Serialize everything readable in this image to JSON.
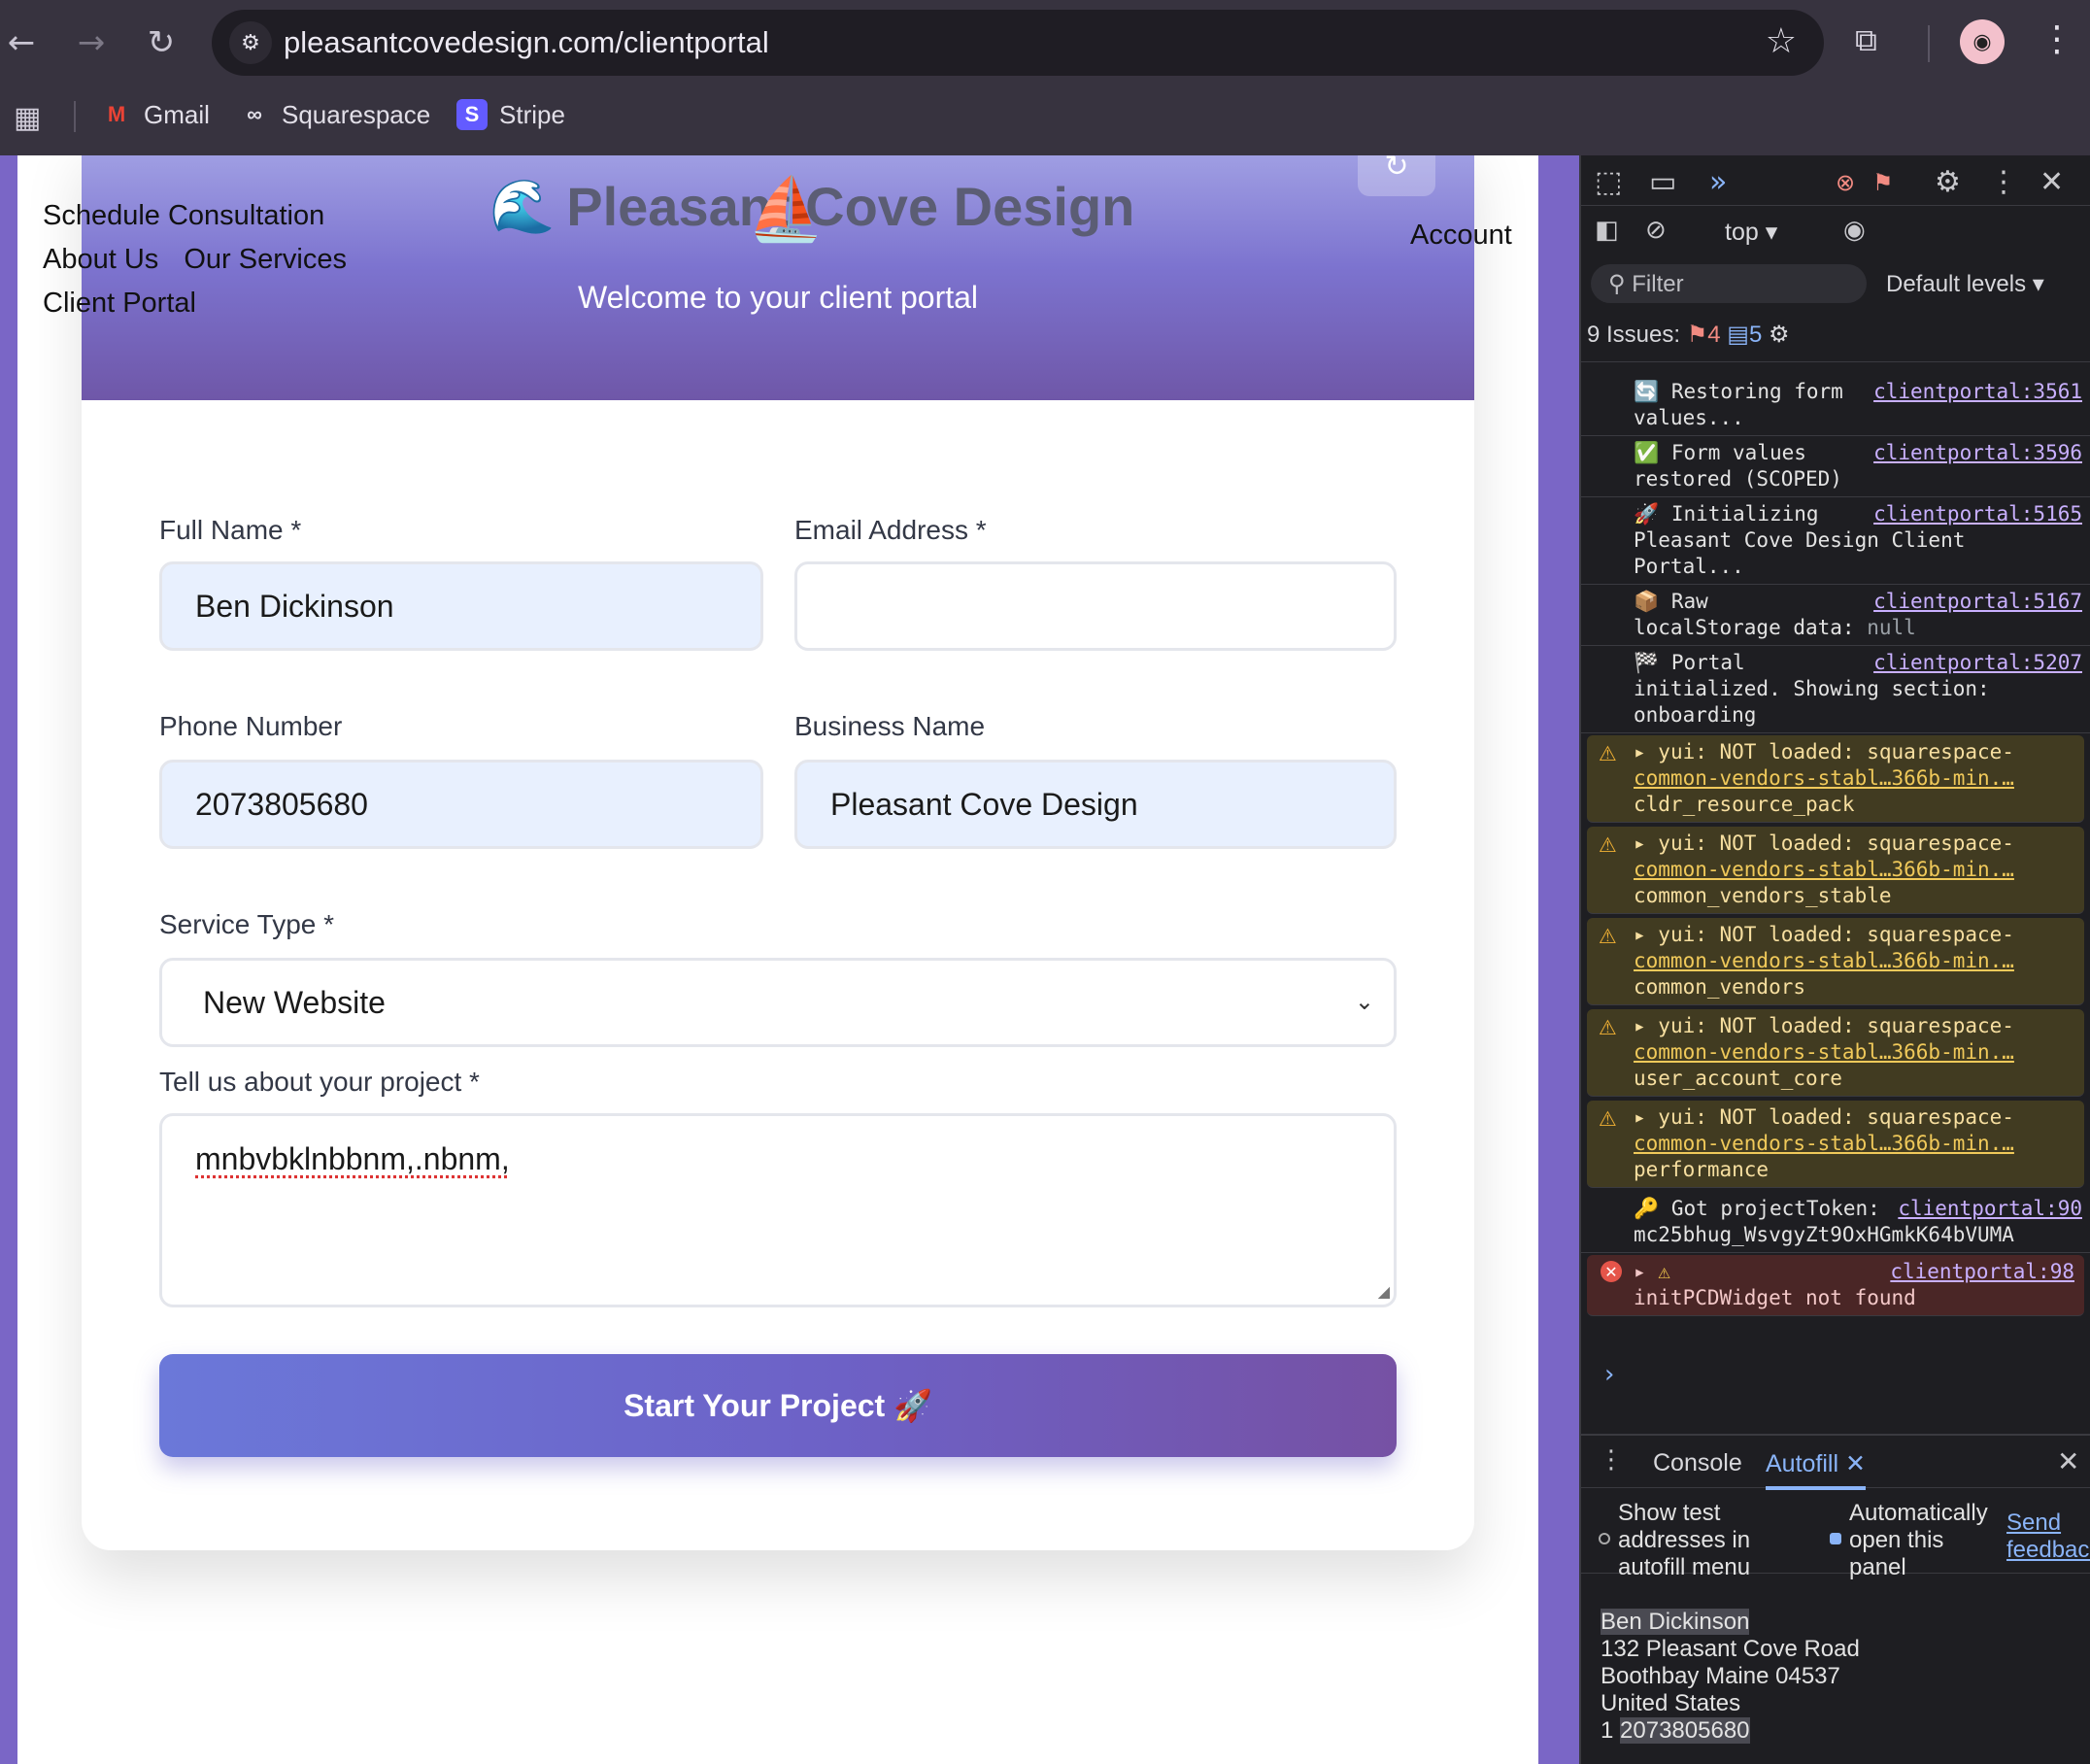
{
  "browser": {
    "url": "pleasantcovedesign.com/clientportal",
    "bookmarks": [
      {
        "label": "Gmail",
        "icon": "gmail-icon"
      },
      {
        "label": "Squarespace",
        "icon": "squarespace-icon"
      },
      {
        "label": "Stripe",
        "icon": "stripe-icon"
      }
    ]
  },
  "site": {
    "nav": [
      "Schedule Consultation",
      "About Us",
      "Our Services",
      "Client Portal"
    ],
    "account": "Account",
    "brand_emoji": "🌊",
    "brand_title": "Pleasant Cove Design",
    "subtitle": "Welcome to your client portal"
  },
  "form": {
    "full_name_label": "Full Name *",
    "full_name_value": "Ben Dickinson",
    "email_label": "Email Address *",
    "email_value": "",
    "phone_label": "Phone Number",
    "phone_value": "2073805680",
    "business_label": "Business Name",
    "business_value": "Pleasant Cove Design",
    "service_label": "Service Type *",
    "service_value": "New Website",
    "project_label": "Tell us about your project *",
    "project_value": "mnbvbklnbbnm,.nbnm,",
    "submit_label": "Start Your Project 🚀"
  },
  "devtools": {
    "context": "top ▾",
    "filter_placeholder": "Filter",
    "levels": "Default levels ▾",
    "issues_label": "9 Issues:",
    "issues_errors": "4",
    "issues_info": "5",
    "logs": [
      {
        "icon": "🔄",
        "text": "Restoring form values...",
        "source": "clientportal:3561"
      },
      {
        "icon": "✅",
        "text": "Form values restored (SCOPED)",
        "source": "clientportal:3596"
      },
      {
        "icon": "🚀",
        "text": "Initializing Pleasant Cove Design Client Portal...",
        "source": "clientportal:5165"
      },
      {
        "icon": "📦",
        "text": "Raw localStorage data: ",
        "null": "null",
        "source": "clientportal:5167"
      },
      {
        "icon": "🏁",
        "text": "Portal initialized. Showing section: onboarding",
        "source": "clientportal:5207"
      }
    ],
    "warnings": [
      {
        "text": "yui: NOT loaded: squarespace-",
        "link": "common-vendors-stabl…366b-min.…",
        "tail": "cldr_resource_pack"
      },
      {
        "text": "yui: NOT loaded: squarespace-",
        "link": "common-vendors-stabl…366b-min.…",
        "tail": "common_vendors_stable"
      },
      {
        "text": "yui: NOT loaded: squarespace-",
        "link": "common-vendors-stabl…366b-min.…",
        "tail": "common_vendors"
      },
      {
        "text": "yui: NOT loaded: squarespace-",
        "link": "common-vendors-stabl…366b-min.…",
        "tail": "user_account_core"
      },
      {
        "text": "yui: NOT loaded: squarespace-",
        "link": "common-vendors-stabl…366b-min.…",
        "tail": "performance"
      }
    ],
    "token_log": {
      "icon": "🔑",
      "text": "Got projectToken: mc25bhug_WsvgyZt9OxHGmkK64bVUMA",
      "source": "clientportal:90"
    },
    "error_log": {
      "text": "initPCDWidget not found",
      "source": "clientportal:98"
    },
    "drawer_tabs": [
      "Console",
      "Autofill"
    ],
    "autofill": {
      "opt1": "Show test addresses in autofill menu",
      "opt2": "Automatically open this panel",
      "feedback": "Send feedback",
      "address": {
        "name": "Ben Dickinson",
        "street": "132 Pleasant Cove Road",
        "city": "Boothbay Maine 04537",
        "country": "United States",
        "phone_prefix": "1",
        "phone": "2073805680"
      }
    }
  }
}
